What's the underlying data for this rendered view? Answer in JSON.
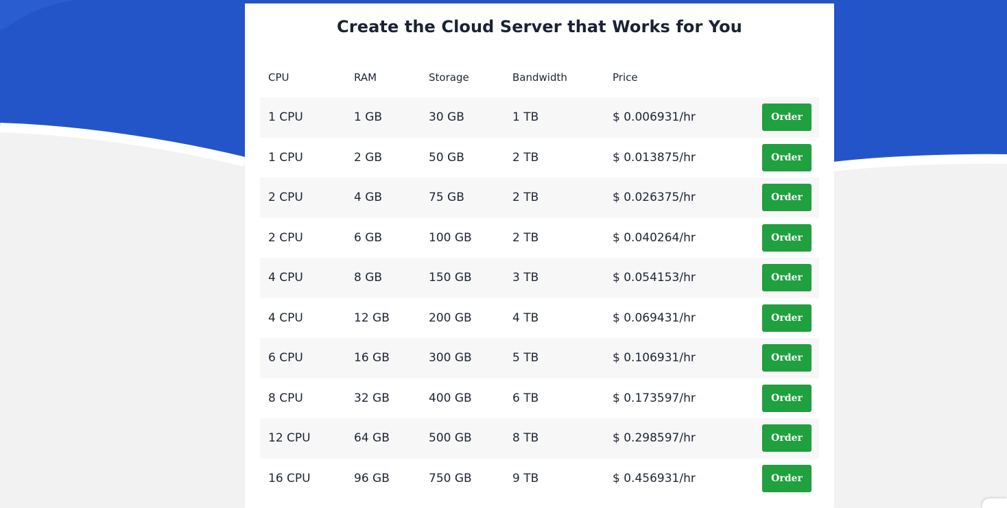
{
  "title": "Create the Cloud Server that Works for You",
  "colors": {
    "hero_blue": "#2455c8",
    "order_green": "#20a03f",
    "row_alt": "#f7f7f7",
    "page_bg": "#f2f2f2"
  },
  "table": {
    "headers": {
      "cpu": "CPU",
      "ram": "RAM",
      "storage": "Storage",
      "bandwidth": "Bandwidth",
      "price": "Price"
    },
    "order_label": "Order",
    "rows": [
      {
        "cpu": "1 CPU",
        "ram": "1 GB",
        "storage": "30 GB",
        "bandwidth": "1 TB",
        "price": "$ 0.006931/hr"
      },
      {
        "cpu": "1 CPU",
        "ram": "2 GB",
        "storage": "50 GB",
        "bandwidth": "2 TB",
        "price": "$ 0.013875/hr"
      },
      {
        "cpu": "2 CPU",
        "ram": "4 GB",
        "storage": "75 GB",
        "bandwidth": "2 TB",
        "price": "$ 0.026375/hr"
      },
      {
        "cpu": "2 CPU",
        "ram": "6 GB",
        "storage": "100 GB",
        "bandwidth": "2 TB",
        "price": "$ 0.040264/hr"
      },
      {
        "cpu": "4 CPU",
        "ram": "8 GB",
        "storage": "150 GB",
        "bandwidth": "3 TB",
        "price": "$ 0.054153/hr"
      },
      {
        "cpu": "4 CPU",
        "ram": "12 GB",
        "storage": "200 GB",
        "bandwidth": "4 TB",
        "price": "$ 0.069431/hr"
      },
      {
        "cpu": "6 CPU",
        "ram": "16 GB",
        "storage": "300 GB",
        "bandwidth": "5 TB",
        "price": "$ 0.106931/hr"
      },
      {
        "cpu": "8 CPU",
        "ram": "32 GB",
        "storage": "400 GB",
        "bandwidth": "6 TB",
        "price": "$ 0.173597/hr"
      },
      {
        "cpu": "12 CPU",
        "ram": "64 GB",
        "storage": "500 GB",
        "bandwidth": "8 TB",
        "price": "$ 0.298597/hr"
      },
      {
        "cpu": "16 CPU",
        "ram": "96 GB",
        "storage": "750 GB",
        "bandwidth": "9 TB",
        "price": "$ 0.456931/hr"
      }
    ]
  }
}
